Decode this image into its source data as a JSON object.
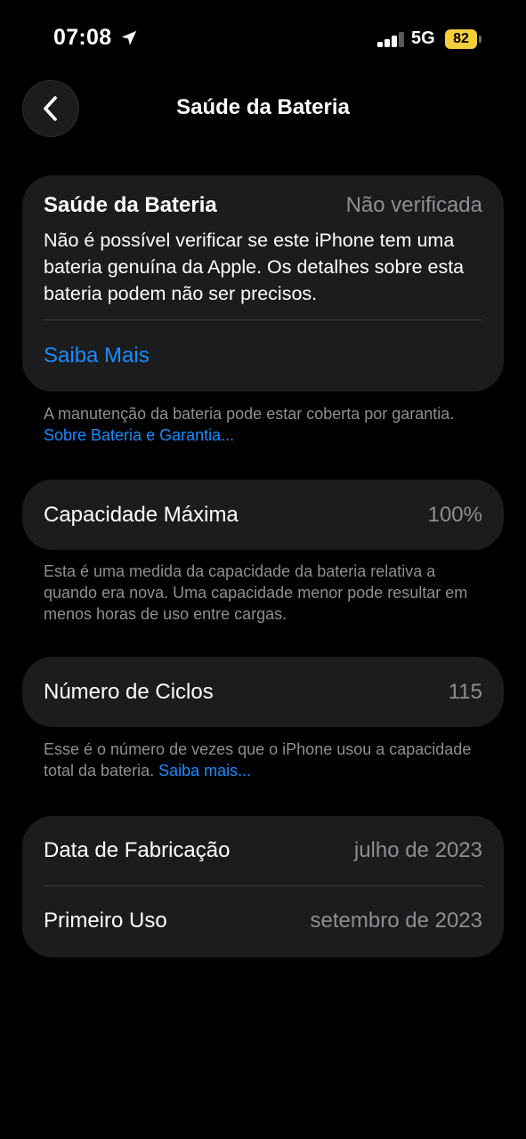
{
  "status_bar": {
    "time": "07:08",
    "network": "5G",
    "battery_level": "82",
    "battery_color": "#f5cf3b"
  },
  "nav": {
    "title": "Saúde da Bateria",
    "back_icon": "chevron-left-icon"
  },
  "health_card": {
    "label": "Saúde da Bateria",
    "status": "Não verificada",
    "message": "Não é possível verificar se este iPhone tem uma bateria genuína da Apple. Os detalhes sobre esta bateria podem não ser precisos.",
    "link": "Saiba Mais"
  },
  "health_footnote": {
    "text": "A manutenção da bateria pode estar coberta por garantia. ",
    "link": "Sobre Bateria e Garantia..."
  },
  "capacity": {
    "label": "Capacidade Máxima",
    "value": "100%"
  },
  "capacity_footnote": {
    "text": "Esta é uma medida da capacidade da bateria relativa a quando era nova. Uma capacidade menor pode resultar em menos horas de uso entre cargas."
  },
  "cycles": {
    "label": "Número de Ciclos",
    "value": "115"
  },
  "cycles_footnote": {
    "text": "Esse é o número de vezes que o iPhone usou a capacidade total da bateria. ",
    "link": "Saiba mais..."
  },
  "dates": {
    "manufacture_label": "Data de Fabricação",
    "manufacture_value": "julho de 2023",
    "first_use_label": "Primeiro Uso",
    "first_use_value": "setembro de 2023"
  },
  "colors": {
    "background": "#000000",
    "card": "#1c1c1e",
    "accent_link": "#1a8cff",
    "secondary_text": "#8e8e93"
  }
}
